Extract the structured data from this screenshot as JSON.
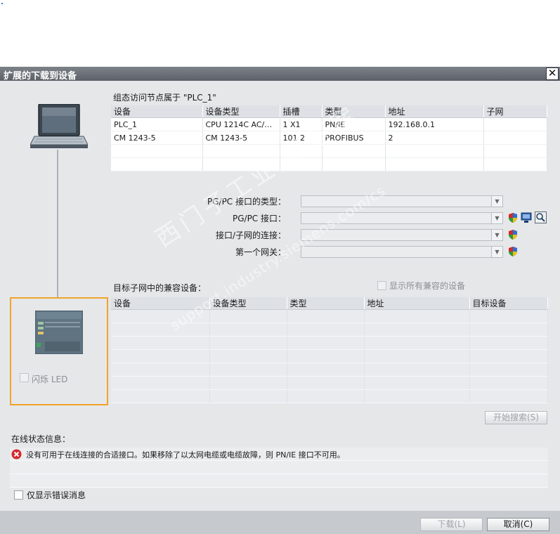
{
  "dialog": {
    "title": "扩展的下载到设备",
    "close_glyph": "✕"
  },
  "config": {
    "heading": "组态访问节点属于 \"PLC_1\"",
    "columns": [
      "设备",
      "设备类型",
      "插槽",
      "类型",
      "地址",
      "子网"
    ],
    "rows": [
      [
        "PLC_1",
        "CPU 1214C AC/D...",
        "1 X1",
        "PN/IE",
        "192.168.0.1",
        ""
      ],
      [
        "CM 1243-5",
        "CM 1243-5",
        "101 2",
        "PROFIBUS",
        "2",
        ""
      ],
      [
        "",
        "",
        "",
        "",
        "",
        ""
      ],
      [
        "",
        "",
        "",
        "",
        "",
        ""
      ]
    ]
  },
  "interface": {
    "pgpc_type_label": "PG/PC 接口的类型：",
    "pgpc_type_value": "",
    "pgpc_interface_label": "PG/PC 接口：",
    "pgpc_interface_value": "",
    "subnet_connection_label": "接口/子网的连接：",
    "subnet_connection_value": "",
    "first_gateway_label": "第一个网关：",
    "first_gateway_value": ""
  },
  "target": {
    "heading": "目标子网中的兼容设备：",
    "show_all_label": "显示所有兼容的设备",
    "show_all_checked": false,
    "columns": [
      "设备",
      "设备类型",
      "类型",
      "地址",
      "目标设备"
    ],
    "rows": [
      [
        "",
        "",
        "",
        "",
        ""
      ],
      [
        "",
        "",
        "",
        "",
        ""
      ],
      [
        "",
        "",
        "",
        "",
        ""
      ],
      [
        "",
        "",
        "",
        "",
        ""
      ],
      [
        "",
        "",
        "",
        "",
        ""
      ],
      [
        "",
        "",
        "",
        "",
        ""
      ],
      [
        "",
        "",
        "",
        "",
        ""
      ]
    ],
    "start_search_label": "开始搜索(S)"
  },
  "device_panel": {
    "flash_led_label": "闪烁 LED",
    "flash_led_checked": false
  },
  "online_status": {
    "heading": "在线状态信息：",
    "messages": [
      {
        "icon": "error-icon",
        "text": "没有可用于在线连接的合适接口。如果移除了以太网电缆或电缆故障，则 PN/IE 接口不可用。"
      },
      {
        "icon": "",
        "text": ""
      },
      {
        "icon": "",
        "text": ""
      }
    ],
    "errors_only_label": "仅显示错误消息",
    "errors_only_checked": false
  },
  "footer": {
    "download_label": "下载(L)",
    "cancel_label": "取消(C)"
  },
  "watermark": {
    "line1": "西门子工业 找答案",
    "line2": "support.industry.siemens.com/cs"
  },
  "colors": {
    "accent_orange": "#f0a32a",
    "error_red": "#d9262c",
    "titlebar": "#5c6168"
  }
}
